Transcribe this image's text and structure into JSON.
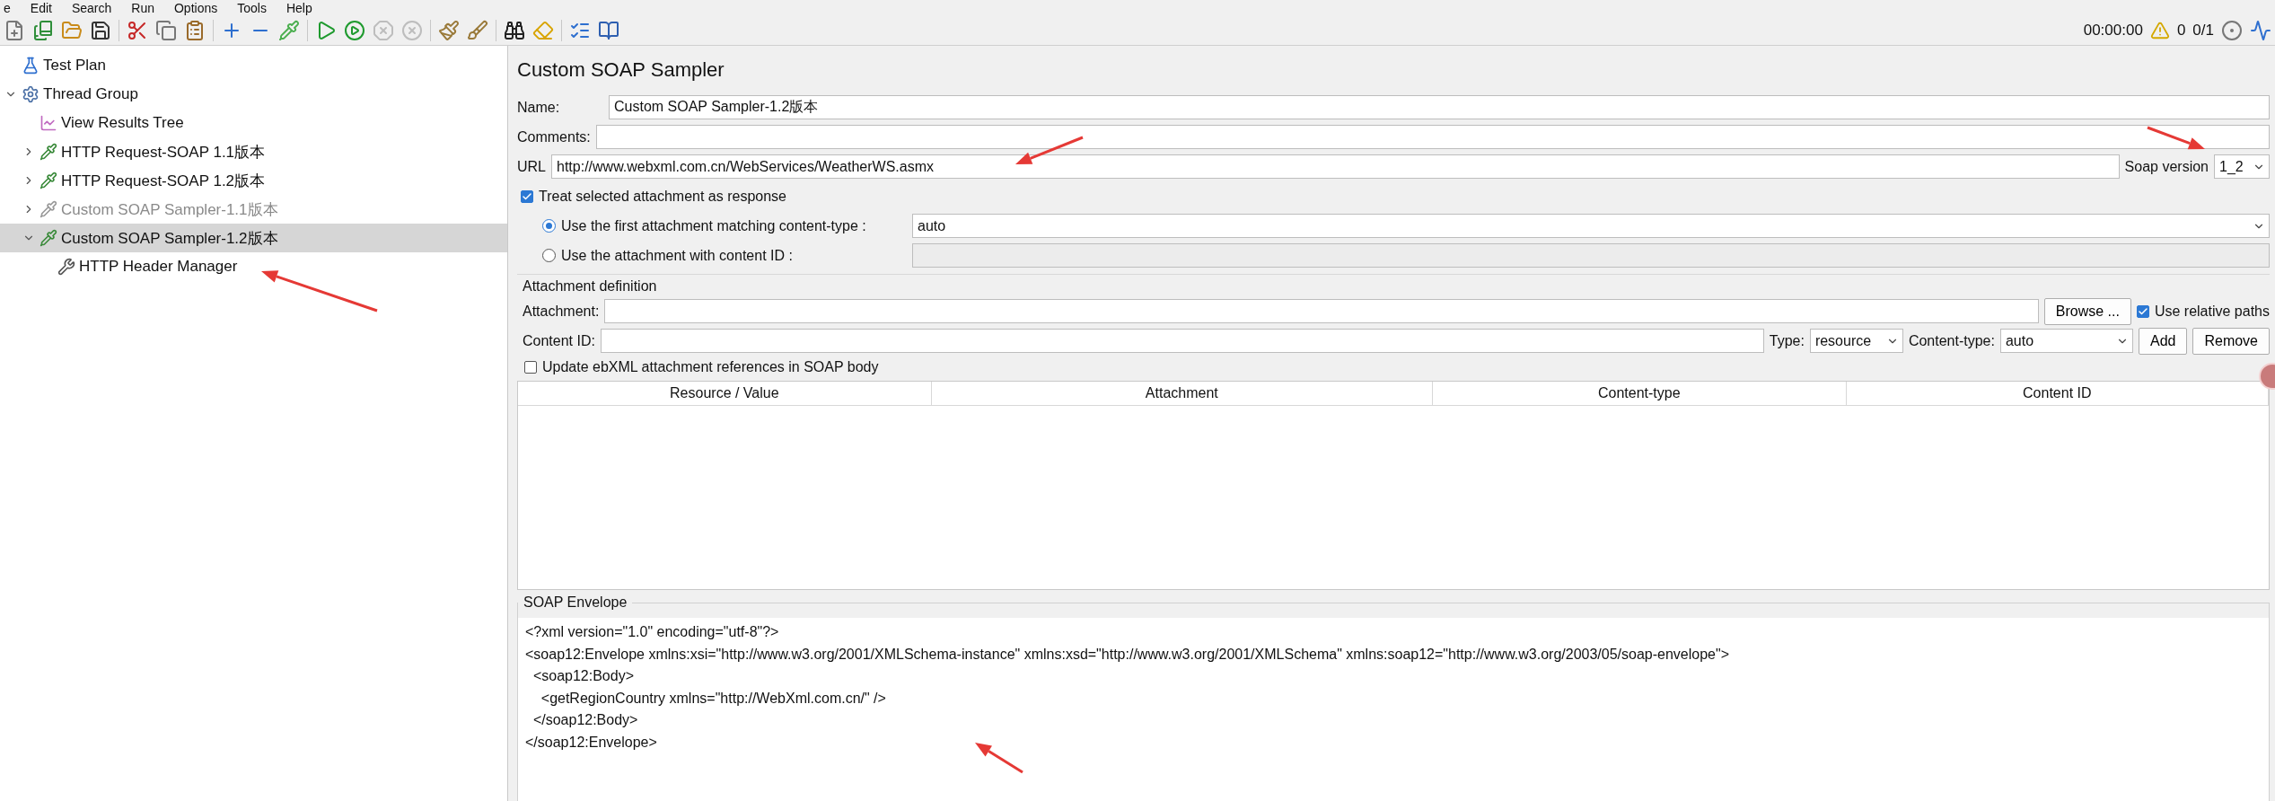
{
  "menu": [
    "e",
    "Edit",
    "Search",
    "Run",
    "Options",
    "Tools",
    "Help"
  ],
  "status": {
    "timer": "00:00:00",
    "warnings": "0",
    "threads": "0/1"
  },
  "tree": [
    {
      "label": "Test Plan",
      "kind": "plan",
      "selected": false,
      "disabled": false
    },
    {
      "label": "Thread Group",
      "kind": "thread-group",
      "expanded": true,
      "selected": false,
      "disabled": false,
      "children": [
        {
          "label": "View Results Tree",
          "kind": "listener",
          "selected": false,
          "disabled": false
        },
        {
          "label": "HTTP Request-SOAP 1.1版本",
          "kind": "sampler",
          "expanded": false,
          "selected": false,
          "disabled": false
        },
        {
          "label": "HTTP Request-SOAP 1.2版本",
          "kind": "sampler",
          "expanded": false,
          "selected": false,
          "disabled": false
        },
        {
          "label": "Custom SOAP Sampler-1.1版本",
          "kind": "sampler",
          "expanded": false,
          "selected": false,
          "disabled": true
        },
        {
          "label": "Custom SOAP Sampler-1.2版本",
          "kind": "sampler",
          "expanded": true,
          "selected": true,
          "disabled": false,
          "children": [
            {
              "label": "HTTP Header Manager",
              "kind": "config",
              "selected": false,
              "disabled": false
            }
          ]
        }
      ]
    }
  ],
  "title": "Custom SOAP Sampler",
  "name": {
    "label": "Name:",
    "value": "Custom SOAP Sampler-1.2版本"
  },
  "comments": {
    "label": "Comments:"
  },
  "url": {
    "label": "URL",
    "value": "http://www.webxml.com.cn/WebServices/WeatherWS.asmx"
  },
  "soap_version": {
    "label": "Soap version",
    "value": "1_2"
  },
  "treat_response": {
    "label": "Treat selected attachment as response",
    "checked": true
  },
  "attachment_options": [
    {
      "label": "Use the first attachment matching content-type :",
      "selected": true,
      "kind": "dropdown",
      "value": "auto"
    },
    {
      "label": "Use the attachment with content ID :",
      "selected": false,
      "kind": "field"
    }
  ],
  "attachment_definition": {
    "title": "Attachment definition",
    "attachment_label": "Attachment:",
    "browse": "Browse ...",
    "relative_paths": {
      "label": "Use relative paths",
      "checked": true
    },
    "content_id_label": "Content ID:",
    "type_label": "Type:",
    "type_value": "resource",
    "content_type_label": "Content-type:",
    "content_type_value": "auto",
    "add": "Add",
    "remove": "Remove"
  },
  "update_ebxml": {
    "label": "Update ebXML attachment references in SOAP body",
    "checked": false
  },
  "table": {
    "columns": [
      "Resource / Value",
      "Attachment",
      "Content-type",
      "Content ID"
    ]
  },
  "envelope": {
    "title": "SOAP Envelope",
    "lines": [
      "<?xml version=\"1.0\" encoding=\"utf-8\"?>",
      "<soap12:Envelope xmlns:xsi=\"http://www.w3.org/2001/XMLSchema-instance\" xmlns:xsd=\"http://www.w3.org/2001/XMLSchema\" xmlns:soap12=\"http://www.w3.org/2003/05/soap-envelope\">",
      "  <soap12:Body>",
      "    <getRegionCountry xmlns=\"http://WebXml.com.cn/\" />",
      "  </soap12:Body>",
      "</soap12:Envelope>"
    ]
  }
}
